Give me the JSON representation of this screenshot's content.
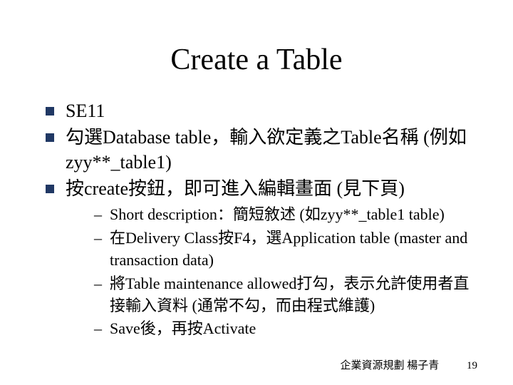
{
  "title": "Create a Table",
  "bullets": {
    "b1": "SE11",
    "b2": "勾選Database table，輸入欲定義之Table名稱  (例如zyy**_table1)",
    "b3": "按create按鈕，即可進入編輯畫面 (見下頁)"
  },
  "subbullets": {
    "s1": "Short description：簡短敘述 (如zyy**_table1 table)",
    "s2": "在Delivery Class按F4，選Application table (master and transaction data)",
    "s3": "將Table maintenance allowed打勾，表示允許使用者直接輸入資料 (通常不勾，而由程式維護)",
    "s4": "Save後，再按Activate"
  },
  "footer": {
    "credit": "企業資源規劃 楊子青",
    "page": "19"
  }
}
